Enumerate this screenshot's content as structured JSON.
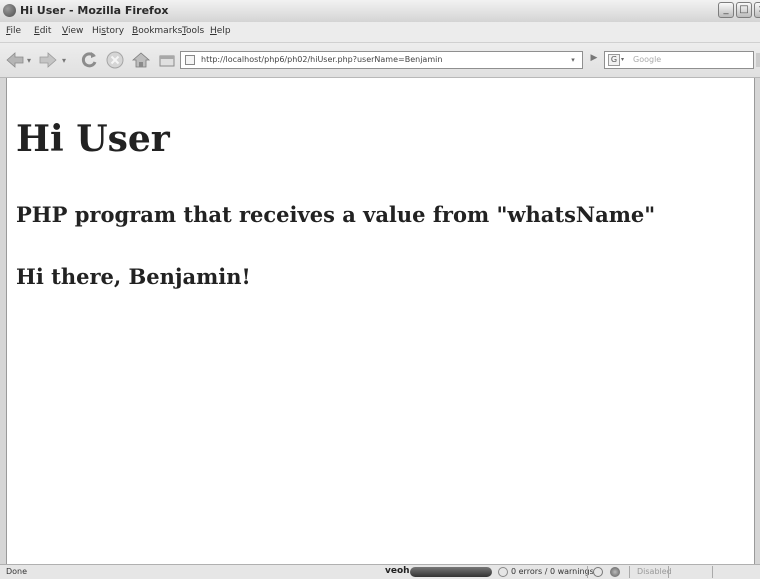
{
  "window": {
    "title": "Hi User - Mozilla Firefox"
  },
  "menu": {
    "items": [
      {
        "label": "File",
        "accel": "F",
        "rest": "ile"
      },
      {
        "label": "Edit",
        "accel": "E",
        "rest": "dit"
      },
      {
        "label": "View",
        "accel": "V",
        "rest": "iew"
      },
      {
        "label": "History",
        "accel": "s",
        "pre": "Hi",
        "rest": "tory"
      },
      {
        "label": "Bookmarks",
        "accel": "B",
        "rest": "ookmarks"
      },
      {
        "label": "Tools",
        "accel": "T",
        "rest": "ools"
      },
      {
        "label": "Help",
        "accel": "H",
        "rest": "elp"
      }
    ]
  },
  "toolbar": {
    "url": "http://localhost/php6/ph02/hiUser.php?userName=Benjamin",
    "search_placeholder": "Google",
    "search_engine_glyph": "G"
  },
  "content": {
    "heading": "Hi User",
    "description": "PHP program that receives a value from \"whatsName\"",
    "greeting": "Hi there, Benjamin!"
  },
  "status": {
    "text": "Done",
    "addon_label": "veoh",
    "errors_text": "0 errors / 0 warnings",
    "disabled_label": "Disabled"
  },
  "colors": {
    "background": "#ffffff",
    "chrome": "#e6e6e6",
    "text": "#222222"
  }
}
